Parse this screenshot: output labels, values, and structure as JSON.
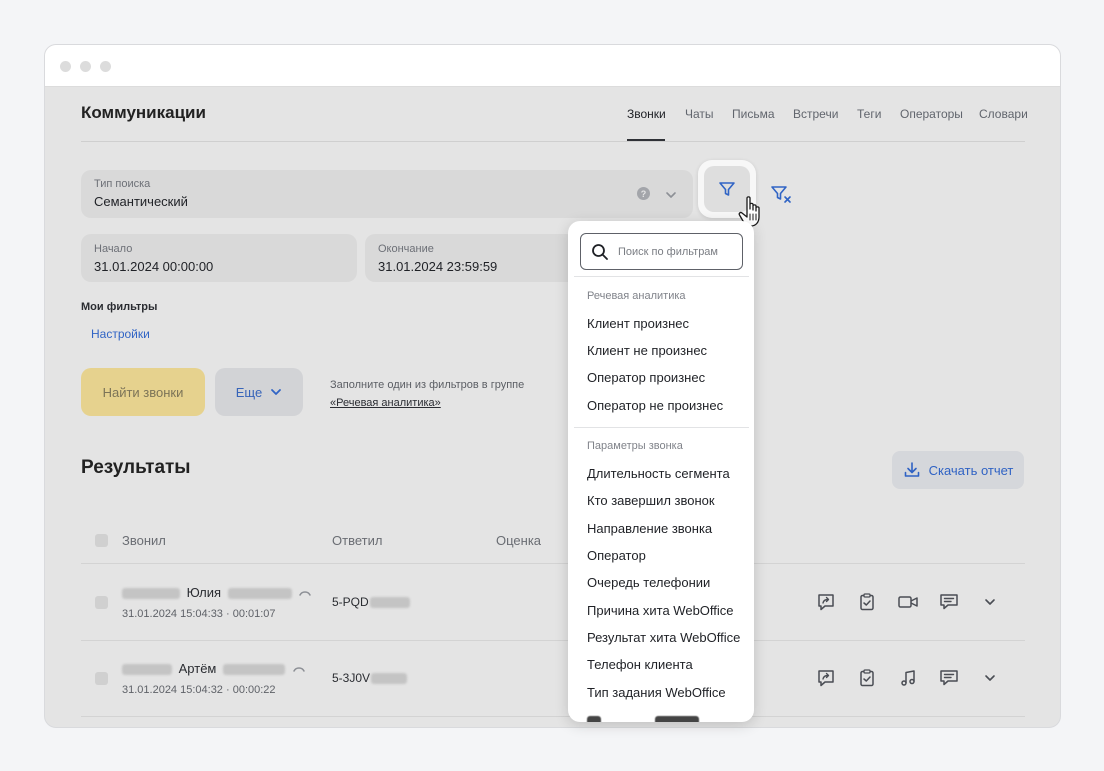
{
  "header": {
    "title": "Коммуникации",
    "tabs": [
      {
        "label": "Звонки",
        "active": true
      },
      {
        "label": "Чаты"
      },
      {
        "label": "Письма"
      },
      {
        "label": "Встречи"
      },
      {
        "label": "Теги"
      },
      {
        "label": "Операторы"
      },
      {
        "label": "Словари"
      }
    ]
  },
  "search_type": {
    "label": "Тип поиска",
    "value": "Семантический"
  },
  "date_range": {
    "start": {
      "label": "Начало",
      "value": "31.01.2024 00:00:00"
    },
    "end": {
      "label": "Окончание",
      "value": "31.01.2024 23:59:59"
    }
  },
  "my_filters": {
    "title": "Мои фильтры",
    "settings_link": "Настройки"
  },
  "actions": {
    "find_button": "Найти звонки",
    "more_button": "Еще",
    "hint_text": "Заполните один из фильтров в группе",
    "hint_link": "«Речевая аналитика»"
  },
  "results": {
    "title": "Результаты",
    "download_button": "Скачать отчет",
    "columns": [
      "Звонил",
      "Ответил",
      "Оценка"
    ],
    "rows": [
      {
        "caller": "Юлия",
        "datetime": "31.01.2024 15:04:33 · 00:01:07",
        "answered": "5-PQD"
      },
      {
        "caller": "Артём",
        "datetime": "31.01.2024 15:04:32 · 00:00:22",
        "answered": "5-3J0V"
      }
    ]
  },
  "filter_dropdown": {
    "search_placeholder": "Поиск по фильтрам",
    "groups": [
      {
        "title": "Речевая аналитика",
        "items": [
          "Клиент произнес",
          "Клиент не произнес",
          "Оператор произнес",
          "Оператор не произнес"
        ]
      },
      {
        "title": "Параметры звонка",
        "items": [
          "Длительность сегмента",
          "Кто завершил звонок",
          "Направление звонка",
          "Оператор",
          "Очередь телефонии",
          "Причина хита WebOffice",
          "Результат хита WebOffice",
          "Телефон клиента",
          "Тип задания WebOffice"
        ]
      }
    ]
  },
  "colors": {
    "accent_blue": "#2f62c4",
    "find_button_bg": "#e6d28e",
    "app_bg": "#e4e4e4"
  }
}
